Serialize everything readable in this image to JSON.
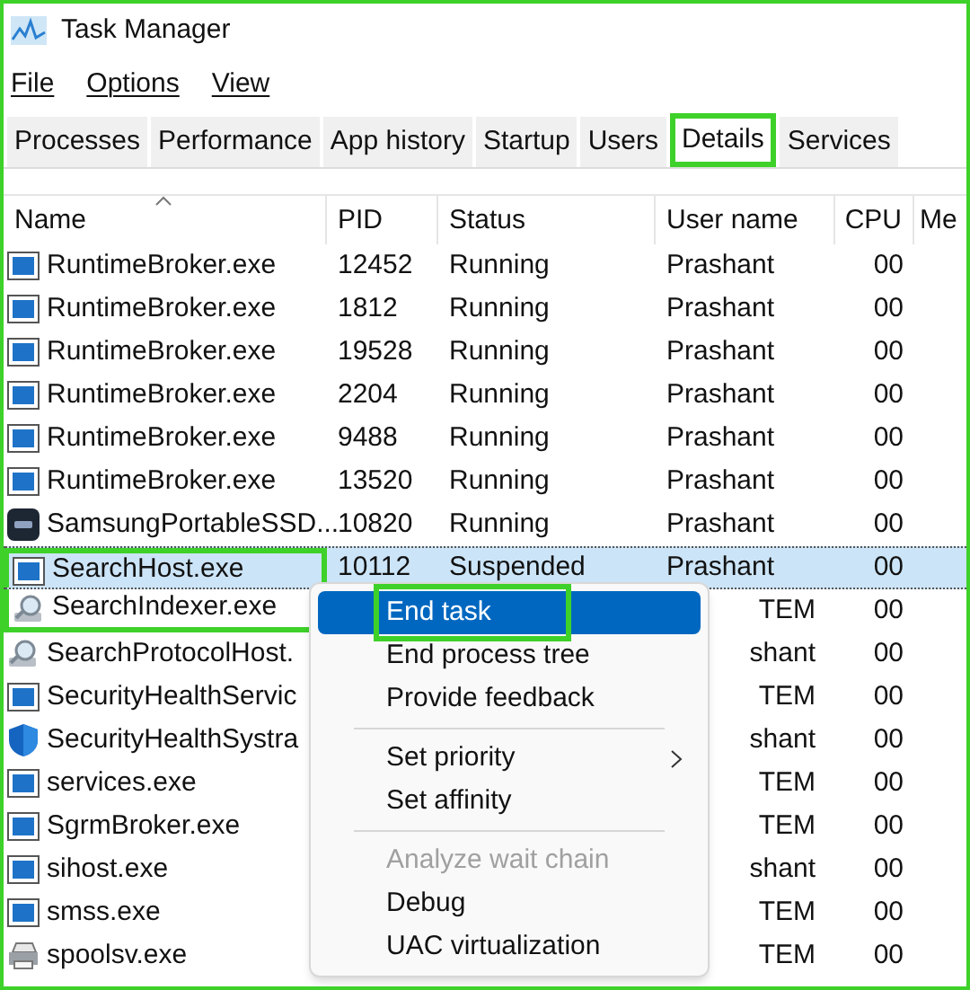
{
  "window": {
    "title": "Task Manager"
  },
  "menu_bar": [
    "File",
    "Options",
    "View"
  ],
  "tabs": [
    {
      "label": "Processes",
      "selected": false,
      "highlighted": false
    },
    {
      "label": "Performance",
      "selected": false,
      "highlighted": false
    },
    {
      "label": "App history",
      "selected": false,
      "highlighted": false
    },
    {
      "label": "Startup",
      "selected": false,
      "highlighted": false
    },
    {
      "label": "Users",
      "selected": false,
      "highlighted": false
    },
    {
      "label": "Details",
      "selected": true,
      "highlighted": true
    },
    {
      "label": "Services",
      "selected": false,
      "highlighted": false
    }
  ],
  "table": {
    "columns": [
      "Name",
      "PID",
      "Status",
      "User name",
      "CPU",
      "Me"
    ],
    "rows": [
      {
        "kind": "app",
        "name": "RuntimeBroker.exe",
        "pid": "12452",
        "status": "Running",
        "user": "Prashant",
        "cpu": "00",
        "selected": false,
        "highlighted": false
      },
      {
        "kind": "app",
        "name": "RuntimeBroker.exe",
        "pid": "1812",
        "status": "Running",
        "user": "Prashant",
        "cpu": "00",
        "selected": false,
        "highlighted": false
      },
      {
        "kind": "app",
        "name": "RuntimeBroker.exe",
        "pid": "19528",
        "status": "Running",
        "user": "Prashant",
        "cpu": "00",
        "selected": false,
        "highlighted": false
      },
      {
        "kind": "app",
        "name": "RuntimeBroker.exe",
        "pid": "2204",
        "status": "Running",
        "user": "Prashant",
        "cpu": "00",
        "selected": false,
        "highlighted": false
      },
      {
        "kind": "app",
        "name": "RuntimeBroker.exe",
        "pid": "9488",
        "status": "Running",
        "user": "Prashant",
        "cpu": "00",
        "selected": false,
        "highlighted": false
      },
      {
        "kind": "app",
        "name": "RuntimeBroker.exe",
        "pid": "13520",
        "status": "Running",
        "user": "Prashant",
        "cpu": "00",
        "selected": false,
        "highlighted": false
      },
      {
        "kind": "ssd",
        "name": "SamsungPortableSSD...",
        "pid": "10820",
        "status": "Running",
        "user": "Prashant",
        "cpu": "00",
        "selected": false,
        "highlighted": false
      },
      {
        "kind": "app",
        "name": "SearchHost.exe",
        "pid": "10112",
        "status": "Suspended",
        "user": "Prashant",
        "cpu": "00",
        "selected": true,
        "highlighted": true
      },
      {
        "kind": "search",
        "name": "SearchIndexer.exe",
        "user": "TEM",
        "cpu": "00",
        "selected": false,
        "highlighted": true
      },
      {
        "kind": "search",
        "name": "SearchProtocolHost.",
        "user": "shant",
        "cpu": "00",
        "selected": false,
        "highlighted": false
      },
      {
        "kind": "app",
        "name": "SecurityHealthServic",
        "user": "TEM",
        "cpu": "00",
        "selected": false,
        "highlighted": false
      },
      {
        "kind": "shield",
        "name": "SecurityHealthSystra",
        "user": "shant",
        "cpu": "00",
        "selected": false,
        "highlighted": false
      },
      {
        "kind": "app",
        "name": "services.exe",
        "user": "TEM",
        "cpu": "00",
        "selected": false,
        "highlighted": false
      },
      {
        "kind": "app",
        "name": "SgrmBroker.exe",
        "user": "TEM",
        "cpu": "00",
        "selected": false,
        "highlighted": false
      },
      {
        "kind": "app",
        "name": "sihost.exe",
        "user": "shant",
        "cpu": "00",
        "selected": false,
        "highlighted": false
      },
      {
        "kind": "app",
        "name": "smss.exe",
        "user": "TEM",
        "cpu": "00",
        "selected": false,
        "highlighted": false
      },
      {
        "kind": "printer",
        "name": "spoolsv.exe",
        "user": "TEM",
        "cpu": "00",
        "selected": false,
        "highlighted": false
      }
    ]
  },
  "context_menu": {
    "items": [
      {
        "kind": "item",
        "label": "End task",
        "selected": true,
        "highlighted": true,
        "disabled": false,
        "submenu": false
      },
      {
        "kind": "item",
        "label": "End process tree",
        "selected": false,
        "highlighted": false,
        "disabled": false,
        "submenu": false
      },
      {
        "kind": "item",
        "label": "Provide feedback",
        "selected": false,
        "highlighted": false,
        "disabled": false,
        "submenu": false
      },
      {
        "kind": "separator"
      },
      {
        "kind": "item",
        "label": "Set priority",
        "selected": false,
        "highlighted": false,
        "disabled": false,
        "submenu": true
      },
      {
        "kind": "item",
        "label": "Set affinity",
        "selected": false,
        "highlighted": false,
        "disabled": false,
        "submenu": false
      },
      {
        "kind": "separator"
      },
      {
        "kind": "item",
        "label": "Analyze wait chain",
        "selected": false,
        "highlighted": false,
        "disabled": true,
        "submenu": false
      },
      {
        "kind": "item",
        "label": "Debug",
        "selected": false,
        "highlighted": false,
        "disabled": false,
        "submenu": false
      },
      {
        "kind": "item",
        "label": "UAC virtualization",
        "selected": false,
        "highlighted": false,
        "disabled": false,
        "submenu": false
      }
    ]
  }
}
